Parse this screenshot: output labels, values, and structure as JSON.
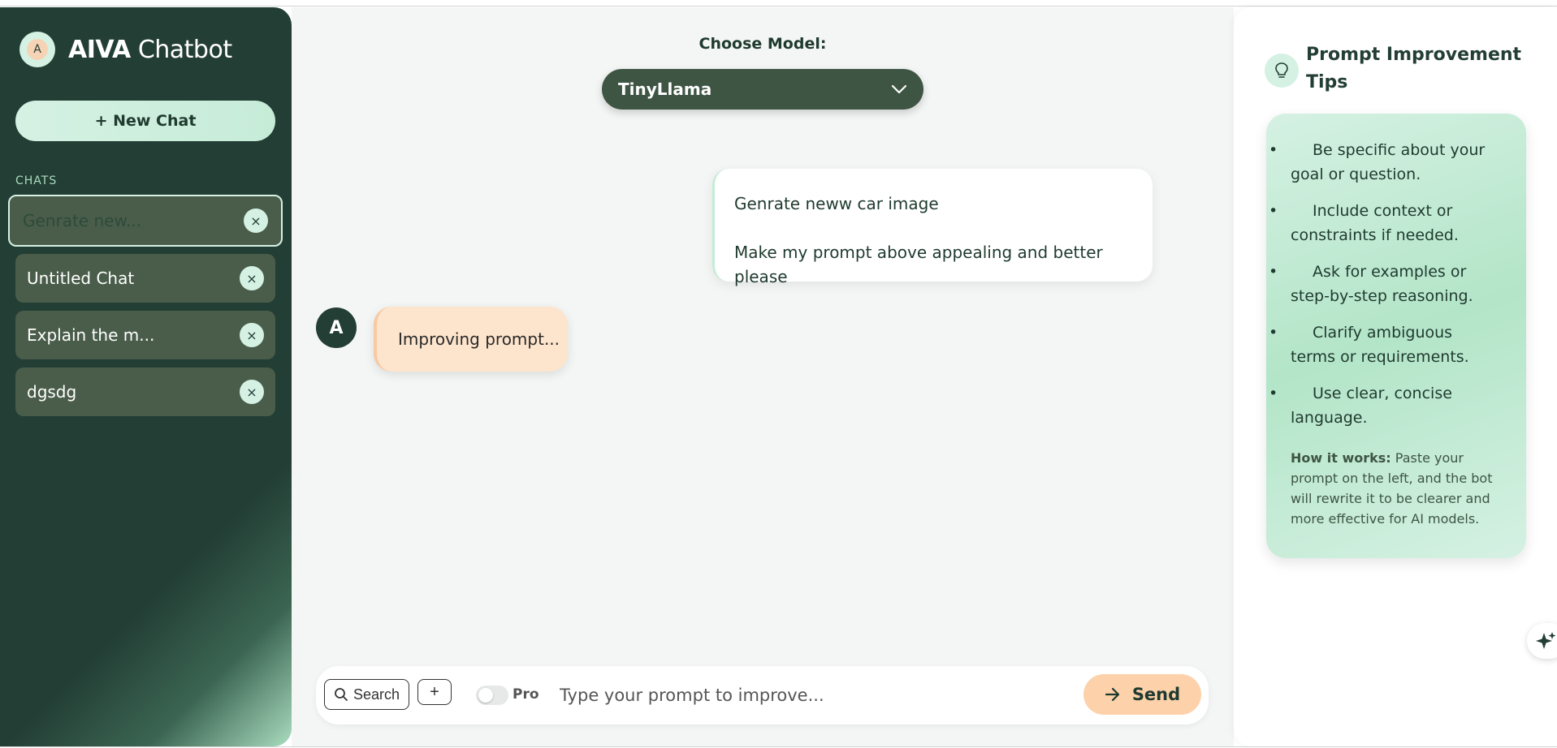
{
  "app": {
    "brand_initial": "A",
    "brand_bold": "AIVA",
    "brand_rest": " Chatbot"
  },
  "sidebar": {
    "new_chat_label": "+ New Chat",
    "section_label": "CHATS",
    "close_glyph": "×",
    "items": [
      {
        "label": "Genrate new...",
        "active": true
      },
      {
        "label": "Untitled Chat",
        "active": false
      },
      {
        "label": "Explain the m...",
        "active": false
      },
      {
        "label": "dgsdg",
        "active": false
      }
    ]
  },
  "model": {
    "label": "Choose Model:",
    "selected": "TinyLlama"
  },
  "messages": {
    "user_line1": "Genrate neww car image",
    "user_line2": "Make my prompt above appealing and better please",
    "bot_initial": "A",
    "bot_text": "Improving prompt..."
  },
  "composer": {
    "search_label": "Search",
    "plus_label": "+",
    "pro_label": "Pro",
    "pro_enabled": false,
    "placeholder": "Type your prompt to improve...",
    "send_label": "Send"
  },
  "tips": {
    "title": "Prompt Improvement Tips",
    "items": [
      "Be specific about your goal or question.",
      "Include context or constraints if needed.",
      "Ask for examples or step-by-step reasoning.",
      "Clarify ambiguous terms or requirements.",
      "Use clear, concise language."
    ],
    "how_label": "How it works:",
    "how_text": " Paste your prompt on the left, and the bot will rewrite it to be clearer and more effective for AI models."
  },
  "colors": {
    "sidebar_bg": "#233e35",
    "accent_mint": "#d5f1e3",
    "accent_peach": "#fdd1aa",
    "model_select_bg": "#3e5544"
  }
}
